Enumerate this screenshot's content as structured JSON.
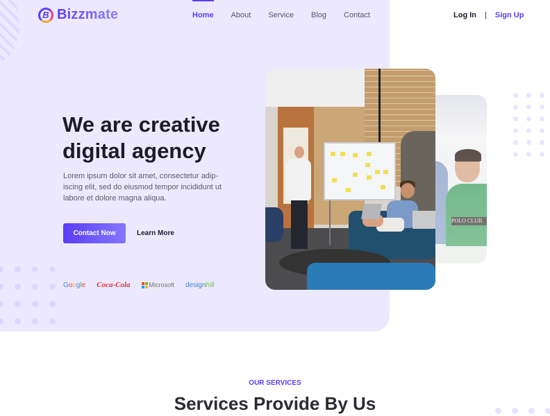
{
  "brand": {
    "name": "Bizzmate",
    "logo_glyph": "B"
  },
  "nav": {
    "items": [
      {
        "label": "Home",
        "active": true
      },
      {
        "label": "About",
        "active": false
      },
      {
        "label": "Service",
        "active": false
      },
      {
        "label": "Blog",
        "active": false
      },
      {
        "label": "Contact",
        "active": false
      }
    ]
  },
  "auth": {
    "login": "Log In",
    "separator": "|",
    "signup": "Sign Up"
  },
  "hero": {
    "title_line1": "We are creative",
    "title_line2": "digital agency",
    "description": "Lorem ipsum dolor sit amet, consectetur adip-iscing elit, sed do eiusmod tempor incididunt ut labore et dolore magna aliqua.",
    "primary_cta": "Contact Now",
    "secondary_cta": "Learn More",
    "brands": [
      "Google",
      "Coca-Cola",
      "Microsoft",
      "designhill"
    ],
    "main_image_alt": "team-meeting-whiteboard-photo",
    "secondary_image_alt": "smiling-man-green-polo-photo",
    "secondary_image_text": "POLO CLUB"
  },
  "services": {
    "eyebrow": "OUR SERVICES",
    "title": "Services Provide By Us"
  },
  "colors": {
    "accent": "#5b3df5",
    "hero_bg": "#ece9ff",
    "text_dark": "#1c1c28",
    "dots": "#dcd7ff"
  }
}
